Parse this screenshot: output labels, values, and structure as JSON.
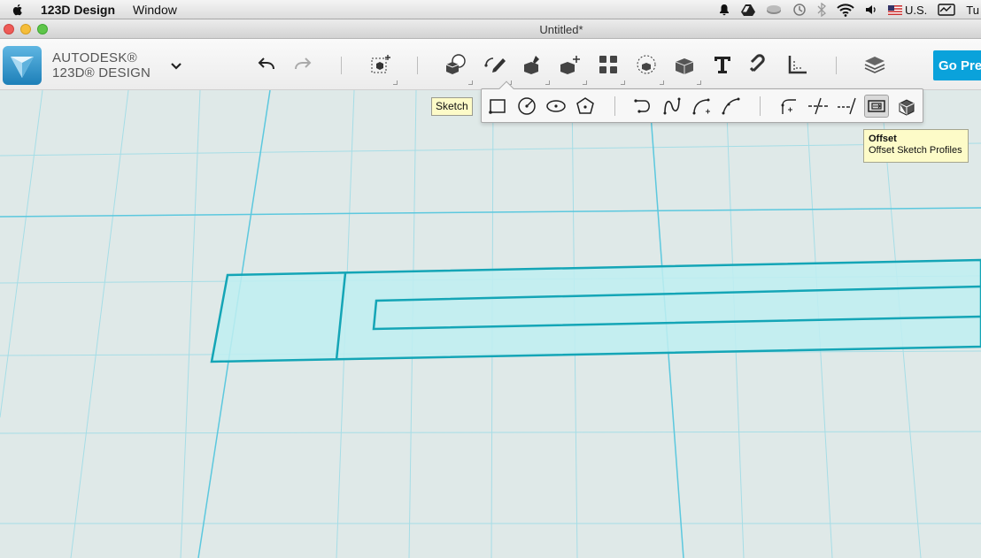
{
  "menubar": {
    "app_name": "123D Design",
    "menus": [
      "Window"
    ],
    "input_source": "U.S.",
    "clock_fragment": "Tu"
  },
  "window": {
    "title": "Untitled*"
  },
  "brand": {
    "line1": "AUTODESK®",
    "line2": "123D® DESIGN"
  },
  "toolbar": {
    "go_premium_label": "Go Pre",
    "tools": [
      "undo",
      "redo",
      "transform",
      "primitives",
      "sketch",
      "construct",
      "modify",
      "pattern",
      "grouping",
      "combine",
      "text",
      "snap",
      "measure",
      "materials"
    ]
  },
  "sketch_tooltip": {
    "label": "Sketch"
  },
  "sketch_flyout": {
    "tools": [
      "sketch-rectangle",
      "sketch-circle",
      "sketch-ellipse",
      "sketch-polygon",
      "polyline",
      "spline",
      "two-point-arc",
      "three-point-arc",
      "fillet",
      "trim",
      "extend",
      "offset",
      "project"
    ],
    "active_tool": "offset"
  },
  "offset_tooltip": {
    "title": "Offset",
    "description": "Offset Sketch Profiles"
  },
  "colors": {
    "accent": "#0aa2db",
    "grid_line": "#8fd4e0",
    "sketch_fill": "#bfeef1",
    "sketch_stroke": "#14a5b6",
    "canvas_bg": "#dfe9e8"
  }
}
